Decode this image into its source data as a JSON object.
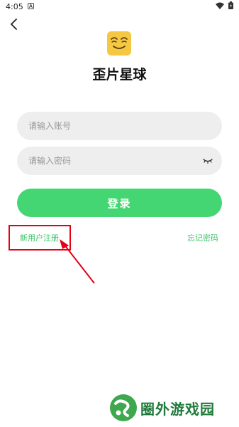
{
  "status_bar": {
    "time": "4:05",
    "notification_icon": "a-icon",
    "wifi_icon": "wifi-icon",
    "battery_icon": "battery-icon"
  },
  "header": {
    "back_icon": "chevron-left-icon"
  },
  "app": {
    "logo_icon": "smiling-face-icon",
    "title": "歪片星球"
  },
  "form": {
    "account_placeholder": "请输入账号",
    "account_value": "",
    "password_placeholder": "请输入密码",
    "password_value": "",
    "eye_icon": "eye-closed-icon",
    "login_label": "登录",
    "register_label": "新用户注册",
    "forgot_label": "忘记密码"
  },
  "annotation": {
    "box_color": "#E60012",
    "arrow_color": "#E60012"
  },
  "watermark": {
    "text": "圈外游戏园"
  },
  "colors": {
    "accent": "#44D672",
    "link": "#3CC56A",
    "field_bg": "#EEEEEE",
    "logo_bg": "#F5C842"
  }
}
